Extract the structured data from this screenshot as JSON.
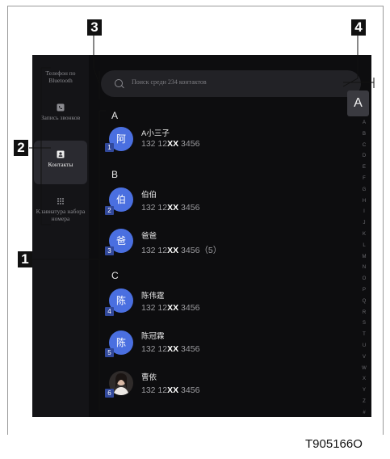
{
  "sidebar": {
    "items": [
      {
        "label": "Телефон по Bluetooth",
        "icon": ""
      },
      {
        "label": "Запись звонков",
        "icon": "phone-icon"
      },
      {
        "label": "Контакты",
        "icon": "contact-card-icon"
      },
      {
        "label": "Клавиатура набора номера",
        "icon": "dialpad-icon"
      }
    ]
  },
  "search": {
    "placeholder": "Поиск среди 234 контактов"
  },
  "contacts": {
    "groups": [
      {
        "letter": "A",
        "entries": [
          {
            "name": "A小三子",
            "avatar": "阿",
            "phone_pre": "132 12",
            "phone_mask": "XX",
            "phone_post": " 3456"
          }
        ]
      },
      {
        "letter": "B",
        "entries": [
          {
            "name": "伯伯",
            "avatar": "伯",
            "phone_pre": "132 12",
            "phone_mask": "XX",
            "phone_post": " 3456"
          },
          {
            "name": "爸爸",
            "avatar": "爸",
            "phone_pre": "132 12",
            "phone_mask": "XX",
            "phone_post": " 3456（5）"
          }
        ]
      },
      {
        "letter": "C",
        "entries": [
          {
            "name": "陈伟霆",
            "avatar": "陈",
            "phone_pre": "132 12",
            "phone_mask": "XX",
            "phone_post": " 3456"
          },
          {
            "name": "陈冠霖",
            "avatar": "陈",
            "phone_pre": "132 12",
            "phone_mask": "XX",
            "phone_post": " 3456"
          },
          {
            "name": "曹依",
            "avatar": "",
            "phone_pre": "132 12",
            "phone_mask": "XX",
            "phone_post": " 3456"
          }
        ]
      }
    ]
  },
  "index": {
    "current": "A",
    "letters": [
      "A",
      "B",
      "C",
      "D",
      "E",
      "F",
      "G",
      "H",
      "I",
      "J",
      "K",
      "L",
      "M",
      "N",
      "O",
      "P",
      "Q",
      "R",
      "S",
      "T",
      "U",
      "V",
      "W",
      "X",
      "Y",
      "Z",
      "#"
    ]
  },
  "callouts": [
    "1",
    "2",
    "3",
    "4"
  ],
  "row_numbers": [
    "1",
    "2",
    "3",
    "4",
    "5",
    "6"
  ],
  "caption": "T905166O",
  "colors": {
    "accent": "#4a6fe0",
    "background": "#0d0d0f",
    "badge": "#31489b"
  }
}
